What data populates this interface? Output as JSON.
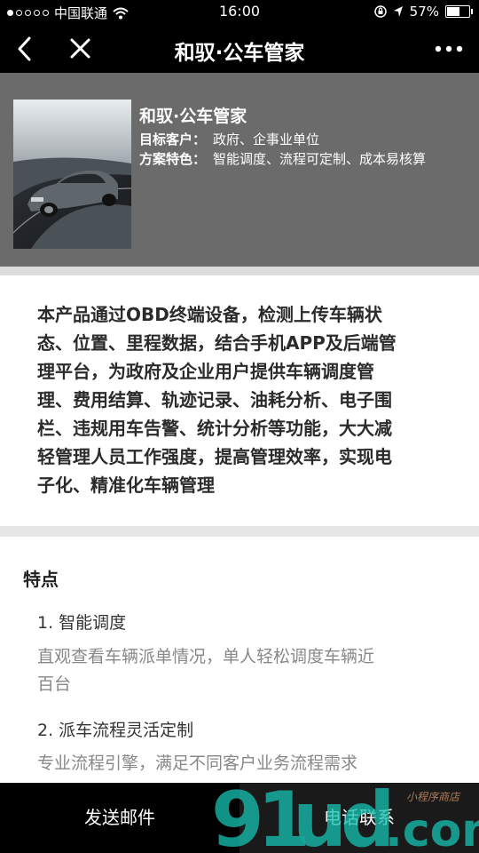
{
  "status_bar": {
    "carrier": "中国联通",
    "time": "16:00",
    "battery": "57%",
    "battery_level": 0.57,
    "signal_bars": 1
  },
  "nav": {
    "title": "和驭·公车管家",
    "back_icon": "chevron-left-icon",
    "close_icon": "close-icon",
    "more_icon": "more-dots-icon"
  },
  "header": {
    "title": "和驭·公车管家",
    "target_label": "目标客户：",
    "target_value": "政府、企事业单位",
    "feature_label": "方案特色：",
    "feature_value": "智能调度、流程可定制、成本易核算",
    "bg_color": "#6b6b6b"
  },
  "intro": {
    "lines": [
      "本产品通过OBD终端设备，检测上传车辆状",
      "态、位置、里程数据，结合手机APP及后端管",
      "理平台，为政府及企业用户提供车辆调度管",
      "理、费用结算、轨迹记录、油耗分析、电子围",
      "栏、违规用车告警、统计分析等功能，大大减",
      "轻管理人员工作强度，提高管理效率，实现电",
      "子化、精准化车辆管理"
    ]
  },
  "features": {
    "title": "特点",
    "items": [
      {
        "heading": "1. 智能调度",
        "desc_lines": [
          "直观查看车辆派单情况，单人轻松调度车辆近",
          "百台"
        ]
      },
      {
        "heading": "2. 派车流程灵活定制",
        "desc_lines": [
          "专业流程引擎，满足不同客户业务流程需求"
        ]
      }
    ]
  },
  "bottom": {
    "email_label": "发送邮件",
    "phone_label": "电话联系"
  },
  "watermark": {
    "text": "91ud.com",
    "small_text": "小程序商店"
  }
}
